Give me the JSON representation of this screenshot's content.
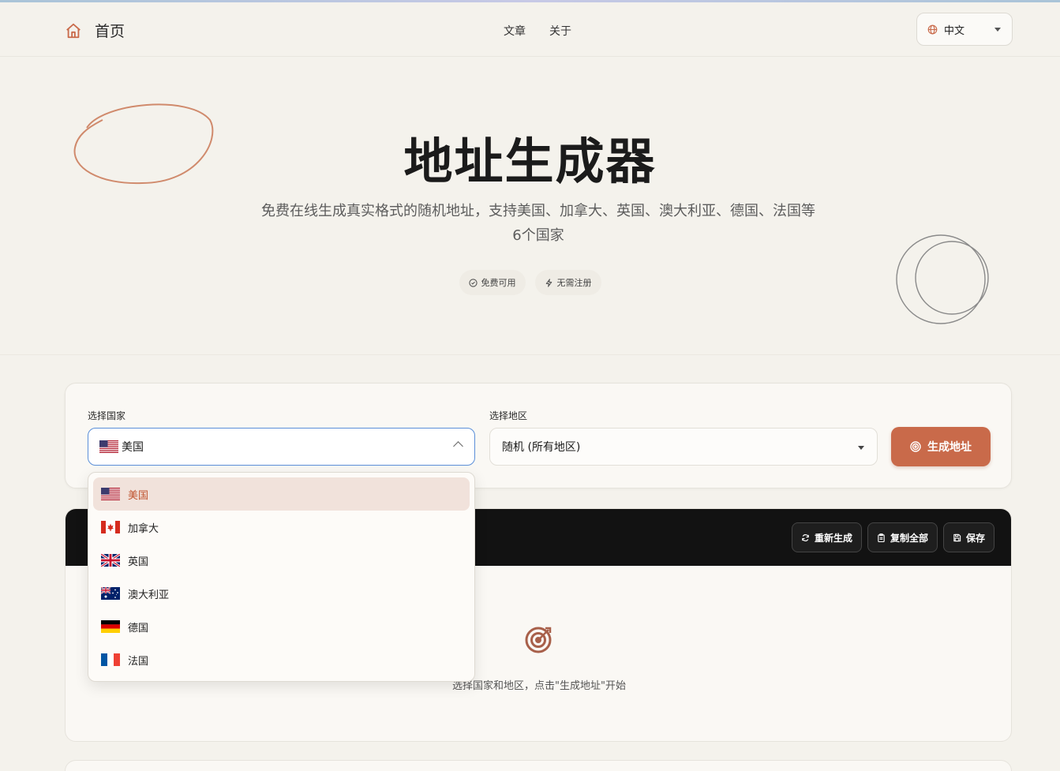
{
  "header": {
    "home_label": "首页",
    "nav": [
      {
        "label": "文章"
      },
      {
        "label": "关于"
      }
    ],
    "language": "中文"
  },
  "hero": {
    "title": "地址生成器",
    "subtitle": "免费在线生成真实格式的随机地址，支持美国、加拿大、英国、澳大利亚、德国、法国等6个国家",
    "badges": [
      {
        "label": "免费可用",
        "icon": "check-circle-icon"
      },
      {
        "label": "无需注册",
        "icon": "lightning-icon"
      }
    ]
  },
  "form": {
    "country_label": "选择国家",
    "country_value": "美国",
    "region_label": "选择地区",
    "region_value": "随机 (所有地区)",
    "generate_label": "生成地址"
  },
  "dropdown": {
    "options": [
      {
        "label": "美国",
        "flag": "us",
        "selected": true
      },
      {
        "label": "加拿大",
        "flag": "ca",
        "selected": false
      },
      {
        "label": "英国",
        "flag": "gb",
        "selected": false
      },
      {
        "label": "澳大利亚",
        "flag": "au",
        "selected": false
      },
      {
        "label": "德国",
        "flag": "de",
        "selected": false
      },
      {
        "label": "法国",
        "flag": "fr",
        "selected": false
      }
    ]
  },
  "result": {
    "regenerate_label": "重新生成",
    "copy_all_label": "复制全部",
    "save_label": "保存",
    "empty_text": "选择国家和地区，点击\"生成地址\"开始"
  },
  "colors": {
    "accent": "#c96a4a",
    "background": "#f4f2ec",
    "dark_bar": "#121212",
    "focus": "#5b8fd8"
  }
}
